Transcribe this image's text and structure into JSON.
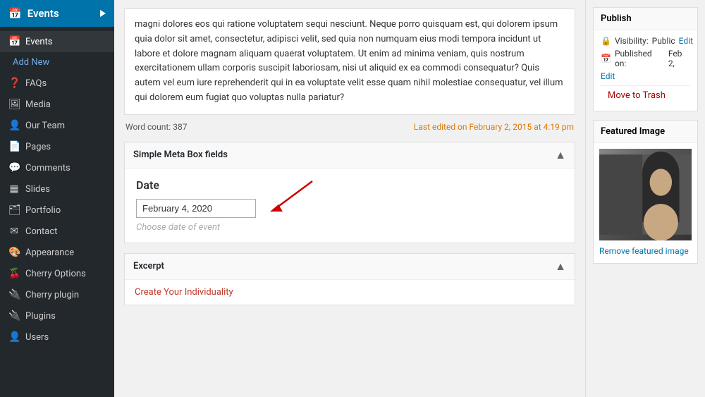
{
  "sidebar": {
    "header": {
      "label": "Events",
      "icon": "📅"
    },
    "items": [
      {
        "id": "events",
        "label": "Events",
        "icon": "📅",
        "active": true,
        "sub": false
      },
      {
        "id": "add-new",
        "label": "Add New",
        "icon": "",
        "active": false,
        "sub": true
      },
      {
        "id": "faqs",
        "label": "FAQs",
        "icon": "❓",
        "active": false,
        "sub": false
      },
      {
        "id": "media",
        "label": "Media",
        "icon": "🖼",
        "active": false,
        "sub": false
      },
      {
        "id": "our-team",
        "label": "Our Team",
        "icon": "👤",
        "active": false,
        "sub": false
      },
      {
        "id": "pages",
        "label": "Pages",
        "icon": "📄",
        "active": false,
        "sub": false
      },
      {
        "id": "comments",
        "label": "Comments",
        "icon": "💬",
        "active": false,
        "sub": false
      },
      {
        "id": "slides",
        "label": "Slides",
        "icon": "▦",
        "active": false,
        "sub": false
      },
      {
        "id": "portfolio",
        "label": "Portfolio",
        "icon": "✉",
        "active": false,
        "sub": false
      },
      {
        "id": "contact",
        "label": "Contact",
        "icon": "✉",
        "active": false,
        "sub": false
      },
      {
        "id": "appearance",
        "label": "Appearance",
        "icon": "🎨",
        "active": false,
        "sub": false
      },
      {
        "id": "cherry-options",
        "label": "Cherry Options",
        "icon": "🍒",
        "active": false,
        "sub": false
      },
      {
        "id": "cherry-plugin",
        "label": "Cherry plugin",
        "icon": "🔌",
        "active": false,
        "sub": false
      },
      {
        "id": "plugins",
        "label": "Plugins",
        "icon": "🔌",
        "active": false,
        "sub": false
      },
      {
        "id": "users",
        "label": "Users",
        "icon": "👤",
        "active": false,
        "sub": false
      }
    ]
  },
  "editor": {
    "body_text": "magni dolores eos qui ratione voluptatem sequi nesciunt. Neque porro quisquam est, qui dolorem ipsum quia dolor sit amet, consectetur, adipisci velit, sed quia non numquam eius modi tempora incidunt ut labore et dolore magnam aliquam quaerat voluptatem. Ut enim ad minima veniam, quis nostrum exercitationem ullam corporis suscipit laboriosam, nisi ut aliquid ex ea commodi consequatur? Quis autem vel eum iure reprehenderit qui in ea voluptate velit esse quam nihil molestiae consequatur, vel illum qui dolorem eum fugiat quo voluptas nulla pariatur?",
    "word_count_label": "Word count:",
    "word_count": "387",
    "last_edited": "Last edited on February 2, 2015 at 4:19 pm"
  },
  "simple_meta_box": {
    "title": "Simple Meta Box fields",
    "date_label": "Date",
    "date_value": "February 4, 2020",
    "date_placeholder": "Choose date of event"
  },
  "excerpt": {
    "title": "Excerpt",
    "text_normal": "Create Your ",
    "text_highlight": "Individuality"
  },
  "publish": {
    "title": "Publish",
    "visibility_label": "Visibility:",
    "visibility_value": "Public",
    "edit_label": "Edit",
    "published_label": "Published on:",
    "published_date": "Feb 2,",
    "edit2_label": "Edit",
    "move_trash": "Move to Trash"
  },
  "featured": {
    "title": "Featured Image",
    "remove_label": "Remove featured image"
  }
}
